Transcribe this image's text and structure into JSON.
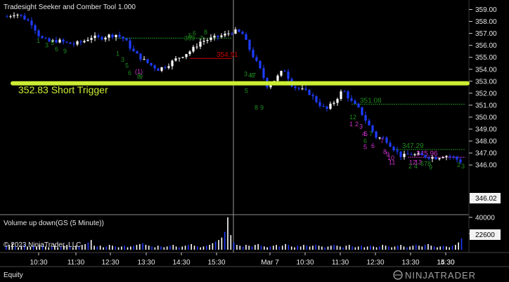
{
  "header": {
    "title": "Tradesight Seeker and Comber Tool 1.000"
  },
  "trigger": {
    "label": "352.83 Short Trigger",
    "price": 352.83,
    "color": "#ccee33"
  },
  "volume_panel": {
    "title": "Volume up down(GS (5 Minute))",
    "last_value": "22600"
  },
  "footer": {
    "copyright": "© 2023 NinjaTrader, LLC",
    "equity_label": "Equity",
    "brand": "NINJATRADER"
  },
  "price_box": {
    "value": "346.02"
  },
  "colors": {
    "up": "#ffffff",
    "down": "#1e3cff",
    "level_green": "#1f8a1f",
    "level_red": "#cc0000",
    "magenta": "#cc33cc",
    "separator": "#888888"
  },
  "chart_data": {
    "type": "candlestick",
    "y_axis": {
      "range": [
        345.5,
        359.4
      ],
      "ticks": [
        "359.00",
        "358.00",
        "357.00",
        "356.00",
        "355.00",
        "354.00",
        "353.00",
        "352.00",
        "351.00",
        "350.00",
        "349.00",
        "348.00",
        "347.00",
        "346.00"
      ]
    },
    "x_axis": {
      "ticks": [
        "10:30",
        "11:30",
        "12:30",
        "13:30",
        "14:30",
        "15:30",
        "Mar 7",
        "10:30",
        "11:30",
        "12:30",
        "13:30",
        "14:30",
        "15:30"
      ]
    },
    "volume_axis": {
      "ticks": [
        "40000",
        "20000"
      ],
      "range": [
        0,
        45000
      ]
    },
    "price_path": [
      [
        0,
        358.4
      ],
      [
        1,
        358.7
      ],
      [
        2,
        358.3
      ],
      [
        3,
        357.8
      ],
      [
        4,
        356.6
      ],
      [
        5,
        356.3
      ],
      [
        6,
        356.4
      ],
      [
        7,
        356.2
      ],
      [
        8,
        356.1
      ],
      [
        9,
        356.3
      ],
      [
        10,
        356.7
      ],
      [
        11,
        356.6
      ],
      [
        12,
        356.8
      ],
      [
        13,
        356.9
      ],
      [
        14,
        356.5
      ],
      [
        15,
        355.5
      ],
      [
        16,
        354.9
      ],
      [
        17,
        354.4
      ],
      [
        18,
        354.0
      ],
      [
        19,
        354.3
      ],
      [
        20,
        354.8
      ],
      [
        21,
        355.2
      ],
      [
        22,
        355.6
      ],
      [
        23,
        356.3
      ],
      [
        24,
        356.5
      ],
      [
        25,
        356.7
      ],
      [
        26,
        356.9
      ],
      [
        27,
        357.2
      ],
      [
        28,
        357.0
      ],
      [
        29,
        355.5
      ],
      [
        30,
        354.2
      ],
      [
        31,
        352.6
      ],
      [
        32,
        353.2
      ],
      [
        33,
        354.0
      ],
      [
        34,
        352.6
      ],
      [
        35,
        352.3
      ],
      [
        36,
        352.0
      ],
      [
        37,
        351.2
      ],
      [
        38,
        350.6
      ],
      [
        39,
        351.3
      ],
      [
        40,
        352.3
      ],
      [
        41,
        351.3
      ],
      [
        42,
        350.6
      ],
      [
        43,
        349.4
      ],
      [
        44,
        348.3
      ],
      [
        45,
        348.2
      ],
      [
        46,
        347.4
      ],
      [
        47,
        346.7
      ],
      [
        48,
        346.9
      ],
      [
        49,
        346.8
      ],
      [
        50,
        346.7
      ],
      [
        51,
        346.6
      ],
      [
        52,
        346.8
      ],
      [
        53,
        346.7
      ],
      [
        54,
        346.3
      ]
    ],
    "volume": [
      5,
      6,
      8,
      4,
      3,
      5,
      6,
      4,
      4,
      5,
      4,
      6,
      5,
      4,
      3,
      4,
      5,
      3,
      4,
      5,
      6,
      4,
      3,
      5,
      4,
      6,
      7,
      9,
      12,
      5,
      4,
      5,
      3,
      4,
      6,
      5,
      4,
      3,
      4,
      5,
      3,
      4,
      5,
      6,
      7,
      8,
      6,
      5,
      4,
      3,
      5,
      4,
      3,
      4,
      5,
      6,
      4,
      3,
      4,
      5,
      6,
      7,
      5,
      4,
      3,
      4,
      5,
      6,
      8,
      10,
      12,
      15,
      22,
      40,
      18,
      9,
      6,
      5,
      4,
      6,
      5,
      4,
      6,
      7,
      5,
      4,
      3,
      4,
      5,
      6,
      4,
      5,
      7,
      6,
      4,
      3,
      5,
      4,
      6,
      5,
      4,
      5,
      6,
      5,
      4,
      3,
      4,
      5,
      6,
      5,
      4,
      3,
      5,
      6,
      4,
      3,
      4,
      5,
      3,
      4,
      5,
      4,
      3,
      4,
      6,
      5,
      4,
      3,
      4,
      5,
      6,
      4,
      3,
      4,
      5,
      6,
      5,
      4,
      6,
      7,
      5,
      4,
      3,
      4,
      5,
      4,
      3,
      5,
      6,
      9,
      14
    ],
    "levels": [
      {
        "label": "",
        "price": 356.6,
        "color": "green",
        "from": 165,
        "to": 330
      },
      {
        "label": "354.91",
        "price": 354.91,
        "color": "red",
        "from": 270,
        "to": 330
      },
      {
        "label": "351.08",
        "price": 351.08,
        "color": "green",
        "from": 500,
        "to": 662
      },
      {
        "label": "347.29",
        "price": 347.29,
        "color": "green",
        "from": 560,
        "to": 662
      },
      {
        "label": "345.96",
        "price": 346.65,
        "color": "magenta",
        "from": 580,
        "to": 662
      }
    ],
    "annotations": [
      {
        "text": "1",
        "price": 356.4,
        "color": "green"
      },
      {
        "text": "3",
        "price": 356.0,
        "color": "green"
      },
      {
        "text": "5",
        "price": 356.2,
        "color": "green"
      },
      {
        "text": "6",
        "price": 355.7,
        "color": "green"
      },
      {
        "text": "9",
        "price": 355.5,
        "color": "green"
      },
      {
        "text": "1",
        "price": 355.3,
        "color": "green"
      },
      {
        "text": "3",
        "price": 354.8,
        "color": "green"
      },
      {
        "text": "5",
        "price": 354.3,
        "color": "green"
      },
      {
        "text": "6",
        "price": 353.7,
        "color": "green"
      },
      {
        "text": "8",
        "price": 353.4,
        "color": "green"
      },
      {
        "text": "9",
        "price": 353.4,
        "color": "green"
      },
      {
        "text": "(1)",
        "price": 353.8,
        "color": "magenta"
      },
      {
        "text": "359",
        "price": 356.6,
        "color": "green"
      },
      {
        "text": "5",
        "price": 356.8,
        "color": "green"
      },
      {
        "text": "6",
        "price": 357.0,
        "color": "green"
      },
      {
        "text": "7",
        "price": 356.6,
        "color": "green"
      },
      {
        "text": "8",
        "price": 357.1,
        "color": "green"
      },
      {
        "text": "3",
        "price": 353.6,
        "color": "green"
      },
      {
        "text": "4",
        "price": 353.5,
        "color": "green"
      },
      {
        "text": "6",
        "price": 353.5,
        "color": "green"
      },
      {
        "text": "7",
        "price": 353.5,
        "color": "green"
      },
      {
        "text": "5",
        "price": 352.2,
        "color": "green"
      },
      {
        "text": "8",
        "price": 350.8,
        "color": "green"
      },
      {
        "text": "9",
        "price": 350.8,
        "color": "green"
      },
      {
        "text": "12",
        "price": 350.0,
        "color": "green"
      },
      {
        "text": "1",
        "price": 349.4,
        "color": "magenta"
      },
      {
        "text": "2",
        "price": 349.4,
        "color": "magenta"
      },
      {
        "text": "3",
        "price": 349.2,
        "color": "magenta"
      },
      {
        "text": "4",
        "price": 348.6,
        "color": "magenta"
      },
      {
        "text": "5",
        "price": 348.6,
        "color": "magenta"
      },
      {
        "text": "7",
        "price": 348.6,
        "color": "green"
      },
      {
        "text": "6",
        "price": 348.0,
        "color": "green"
      },
      {
        "text": "5",
        "price": 347.5,
        "color": "magenta"
      },
      {
        "text": "6",
        "price": 347.6,
        "color": "magenta"
      },
      {
        "text": "7",
        "price": 348.0,
        "color": "magenta"
      },
      {
        "text": "8",
        "price": 347.1,
        "color": "magenta"
      },
      {
        "text": "9",
        "price": 346.9,
        "color": "magenta"
      },
      {
        "text": "10",
        "price": 346.6,
        "color": "magenta"
      },
      {
        "text": "11",
        "price": 346.2,
        "color": "magenta"
      },
      {
        "text": "12",
        "price": 346.2,
        "color": "magenta"
      },
      {
        "text": "13",
        "price": 346.2,
        "color": "magenta"
      },
      {
        "text": "2",
        "price": 345.9,
        "color": "green"
      },
      {
        "text": "4",
        "price": 345.9,
        "color": "green"
      },
      {
        "text": "6",
        "price": 346.1,
        "color": "green"
      },
      {
        "text": "7",
        "price": 346.1,
        "color": "green"
      },
      {
        "text": "8",
        "price": 346.1,
        "color": "green"
      },
      {
        "text": "9",
        "price": 345.8,
        "color": "green"
      },
      {
        "text": "2",
        "price": 346.0,
        "color": "green"
      },
      {
        "text": "3",
        "price": 345.9,
        "color": "green"
      }
    ]
  }
}
